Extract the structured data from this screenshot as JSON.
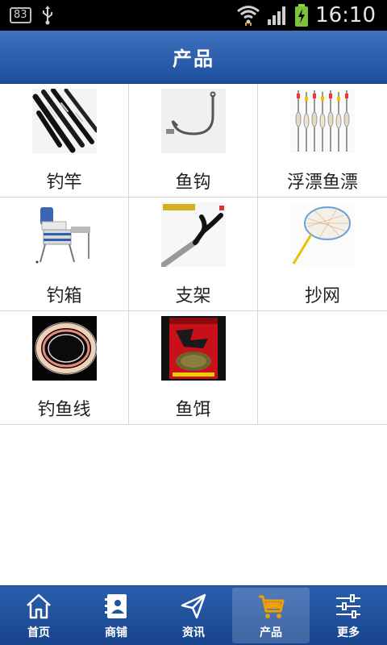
{
  "status_bar": {
    "badge": "83",
    "time": "16:10"
  },
  "header": {
    "title": "产品"
  },
  "products": [
    {
      "label": "钓竿",
      "icon": "fishing-rod"
    },
    {
      "label": "鱼钩",
      "icon": "fish-hook"
    },
    {
      "label": "浮漂鱼漂",
      "icon": "fishing-floats"
    },
    {
      "label": "钓箱",
      "icon": "fishing-box"
    },
    {
      "label": "支架",
      "icon": "rod-holder"
    },
    {
      "label": "抄网",
      "icon": "landing-net"
    },
    {
      "label": "钓鱼线",
      "icon": "fishing-line"
    },
    {
      "label": "鱼饵",
      "icon": "fish-bait"
    }
  ],
  "tabs": [
    {
      "label": "首页",
      "icon": "home-icon"
    },
    {
      "label": "商铺",
      "icon": "contacts-icon"
    },
    {
      "label": "资讯",
      "icon": "send-icon"
    },
    {
      "label": "产品",
      "icon": "cart-icon",
      "active": true
    },
    {
      "label": "更多",
      "icon": "sliders-icon"
    }
  ],
  "colors": {
    "header": "#2a5fae",
    "tabbar": "#1f54a0",
    "battery_green": "#7cc23a"
  }
}
